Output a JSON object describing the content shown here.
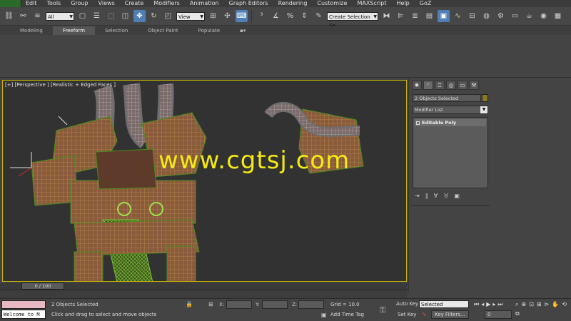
{
  "menu": {
    "items": [
      "Edit",
      "Tools",
      "Group",
      "Views",
      "Create",
      "Modifiers",
      "Animation",
      "Graph Editors",
      "Rendering",
      "Customize",
      "MAXScript",
      "Help",
      "GoZ"
    ]
  },
  "toolbar": {
    "filter_value": "All",
    "refcoord_value": "View",
    "selection_set_placeholder": "Create Selection Se"
  },
  "ribbon": {
    "tabs": [
      "Modeling",
      "Freeform",
      "Selection",
      "Object Paint",
      "Populate"
    ],
    "active_tab": "Freeform"
  },
  "viewport": {
    "label": "[+] [Perspective ] [Realistic + Edged Faces ]",
    "watermark": "www.cgtsj.com",
    "watermark_color": "#f2ea14",
    "border_color": "#c8b400"
  },
  "command_panel": {
    "object_name": "2 Objects Selected",
    "modifier_list": "Modifier List",
    "stack_item": "Editable Poly"
  },
  "timeline": {
    "slider_label": "0 / 100"
  },
  "status": {
    "listener_text": "Welcome to M",
    "selection_text": "2 Objects Selected",
    "prompt_text": "Click and drag to select and move objects",
    "x_label": "X:",
    "y_label": "Y:",
    "z_label": "Z:",
    "grid_text": "Grid = 10.0",
    "add_time_tag": "Add Time Tag",
    "auto_key": "Auto Key",
    "set_key": "Set Key",
    "selected_value": "Selected",
    "key_filters": "Key Filters...",
    "frame_value": "0"
  }
}
